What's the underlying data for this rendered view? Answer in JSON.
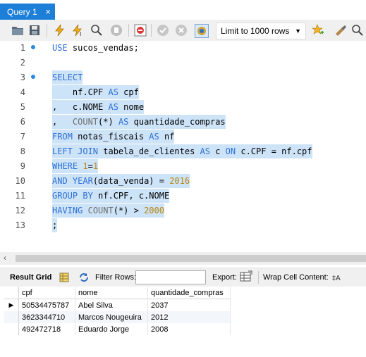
{
  "tab": {
    "title": "Query 1",
    "close": "×"
  },
  "toolbar": {
    "limit_value": "Limit to 1000 rows"
  },
  "editor": {
    "line_numbers": [
      "1",
      "2",
      "3",
      "4",
      "5",
      "6",
      "7",
      "8",
      "9",
      "10",
      "11",
      "12",
      "13"
    ],
    "lines": [
      [
        [
          "kw",
          "USE"
        ],
        [
          "tx",
          " sucos_vendas;"
        ]
      ],
      [],
      [
        [
          "kw",
          "SELECT"
        ]
      ],
      [
        [
          "tx",
          "    nf.CPF "
        ],
        [
          "kw",
          "AS"
        ],
        [
          "tx",
          " cpf"
        ]
      ],
      [
        [
          "tx",
          ",   c.NOME "
        ],
        [
          "kw",
          "AS"
        ],
        [
          "tx",
          " nome"
        ]
      ],
      [
        [
          "tx",
          ",   "
        ],
        [
          "fn",
          "COUNT"
        ],
        [
          "tx",
          "(*) "
        ],
        [
          "kw",
          "AS"
        ],
        [
          "tx",
          " quantidade_compras"
        ]
      ],
      [
        [
          "kw",
          "FROM"
        ],
        [
          "tx",
          " notas_fiscais "
        ],
        [
          "kw",
          "AS"
        ],
        [
          "tx",
          " nf"
        ]
      ],
      [
        [
          "kw",
          "LEFT JOIN"
        ],
        [
          "tx",
          " tabela_de_clientes "
        ],
        [
          "kw",
          "AS"
        ],
        [
          "tx",
          " c "
        ],
        [
          "kw",
          "ON"
        ],
        [
          "tx",
          " c.CPF = nf.cpf"
        ]
      ],
      [
        [
          "kw",
          "WHERE"
        ],
        [
          "tx",
          " "
        ],
        [
          "num",
          "1"
        ],
        [
          "tx",
          "="
        ],
        [
          "num",
          "1"
        ]
      ],
      [
        [
          "kw",
          "AND"
        ],
        [
          "tx",
          " "
        ],
        [
          "kw",
          "YEAR"
        ],
        [
          "tx",
          "(data_venda) = "
        ],
        [
          "num",
          "2016"
        ]
      ],
      [
        [
          "kw",
          "GROUP BY"
        ],
        [
          "tx",
          " nf.CPF, c.NOME"
        ]
      ],
      [
        [
          "kw",
          "HAVING"
        ],
        [
          "tx",
          " "
        ],
        [
          "fn",
          "COUNT"
        ],
        [
          "tx",
          "(*) > "
        ],
        [
          "num",
          "2000"
        ]
      ],
      [
        [
          "tx",
          ";"
        ]
      ]
    ]
  },
  "result_toolbar": {
    "result_grid_label": "Result Grid",
    "filter_label": "Filter Rows:",
    "export_label": "Export:",
    "wrap_label": "Wrap Cell Content:"
  },
  "grid": {
    "columns": [
      "cpf",
      "nome",
      "quantidade_compras"
    ],
    "rows": [
      [
        "50534475787",
        "Abel Silva",
        "2037"
      ],
      [
        "3623344710",
        "Marcos Nougeuira",
        "2012"
      ],
      [
        "492472718",
        "Eduardo Jorge",
        "2008"
      ]
    ]
  }
}
